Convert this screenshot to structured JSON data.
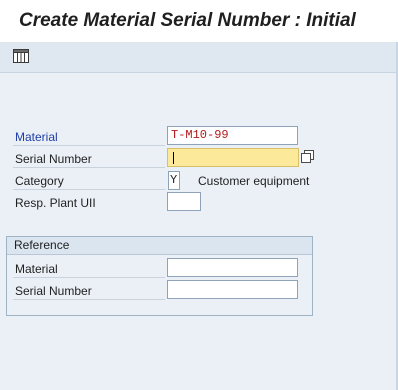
{
  "title": "Create Material Serial Number : Initial",
  "toolbar": {
    "buttons": [
      {
        "icon": "table-settings-icon"
      }
    ]
  },
  "form": {
    "material": {
      "label": "Material",
      "value": "T-M10-99"
    },
    "serial_number": {
      "label": "Serial Number",
      "value": ""
    },
    "category": {
      "label": "Category",
      "value": "Y",
      "description": "Customer equipment"
    },
    "resp_plant_uii": {
      "label": "Resp. Plant UII",
      "value": ""
    }
  },
  "reference": {
    "title": "Reference",
    "material": {
      "label": "Material",
      "value": ""
    },
    "serial_number": {
      "label": "Serial Number",
      "value": ""
    }
  },
  "colors": {
    "required_label": "#1f3ea6",
    "material_value": "#b21a1a",
    "focused_field": "#fde99a",
    "toolbar_bg": "#dfe8f1",
    "content_bg": "#eaf0f6"
  }
}
